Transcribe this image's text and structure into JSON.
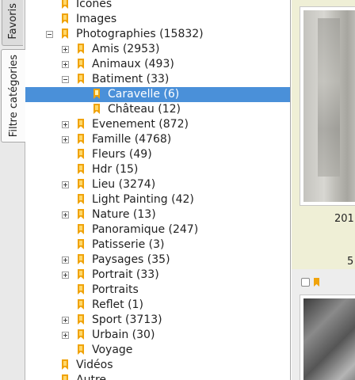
{
  "sidebar": {
    "tabs": [
      {
        "label": "Favoris"
      },
      {
        "label": "Filtre catégories"
      }
    ]
  },
  "tree": {
    "items": [
      {
        "label": "Icones",
        "expander": "none"
      },
      {
        "label": "Images",
        "expander": "none"
      },
      {
        "label": "Photographies (15832)",
        "expander": "minus"
      },
      {
        "label": "Amis (2953)",
        "expander": "plus"
      },
      {
        "label": "Animaux (493)",
        "expander": "plus"
      },
      {
        "label": "Batiment (33)",
        "expander": "minus"
      },
      {
        "label": "Caravelle (6)",
        "expander": "none",
        "selected": true
      },
      {
        "label": "Château (12)",
        "expander": "none"
      },
      {
        "label": "Evenement (872)",
        "expander": "plus"
      },
      {
        "label": "Famille (4768)",
        "expander": "plus"
      },
      {
        "label": "Fleurs (49)",
        "expander": "none"
      },
      {
        "label": "Hdr (15)",
        "expander": "none"
      },
      {
        "label": "Lieu (3274)",
        "expander": "plus"
      },
      {
        "label": "Light Painting (42)",
        "expander": "none"
      },
      {
        "label": "Nature (13)",
        "expander": "plus"
      },
      {
        "label": "Panoramique (247)",
        "expander": "none"
      },
      {
        "label": "Patisserie (3)",
        "expander": "none"
      },
      {
        "label": "Paysages (35)",
        "expander": "plus"
      },
      {
        "label": "Portrait (33)",
        "expander": "plus"
      },
      {
        "label": "Portraits",
        "expander": "none"
      },
      {
        "label": "Reflet (1)",
        "expander": "none"
      },
      {
        "label": "Sport (3713)",
        "expander": "plus"
      },
      {
        "label": "Urbain (30)",
        "expander": "plus"
      },
      {
        "label": "Voyage",
        "expander": "none"
      },
      {
        "label": "Vidéos",
        "expander": "none"
      },
      {
        "label": "Autre",
        "expander": "none"
      }
    ]
  },
  "content": {
    "cards": [
      {
        "caption": "201",
        "detail": "5"
      },
      {
        "caption": "",
        "detail": ""
      }
    ]
  },
  "colors": {
    "selection": "#4a90d9",
    "bookmark": "#f0a30a",
    "card_highlight": "#efefd6"
  }
}
